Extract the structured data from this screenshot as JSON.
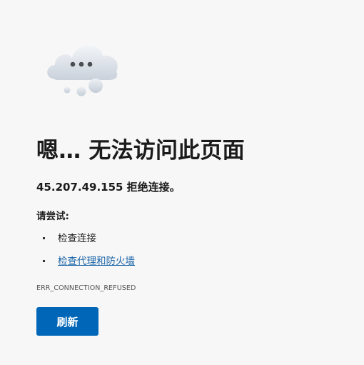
{
  "illustration": {
    "icon": "cloud-with-ellipsis-icon"
  },
  "title": "嗯… 无法访问此页面",
  "summary": "45.207.49.155 拒绝连接。",
  "try_heading": "请尝试:",
  "suggestions": [
    {
      "label": "检查连接",
      "is_link": false
    },
    {
      "label": "检查代理和防火墙",
      "is_link": true
    }
  ],
  "error_code": "ERR_CONNECTION_REFUSED",
  "refresh_label": "刷新",
  "colors": {
    "background": "#f7f7f7",
    "button": "#0067b8",
    "link": "#1a64a8"
  }
}
